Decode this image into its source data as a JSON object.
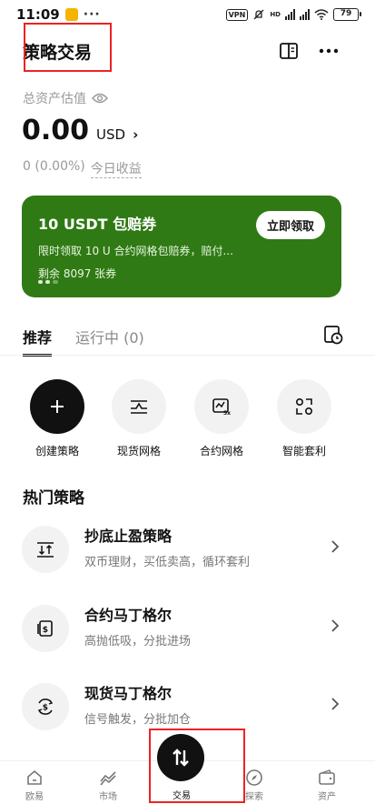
{
  "status_bar": {
    "time": "11:09",
    "dots": "···",
    "vpn": "VPN",
    "signal1": "HD",
    "battery": "79"
  },
  "header": {
    "title": "策略交易"
  },
  "assets": {
    "label": "总资产估值",
    "amount": "0.00",
    "currency": "USD",
    "arrow": "›",
    "pnl_value": "0 (0.00%)",
    "pnl_label": "今日收益"
  },
  "banner": {
    "title": "10 USDT 包赔券",
    "description": "限时领取 10 U 合约网格包赔券，赔付...",
    "remaining": "剩余 8097 张券",
    "button": "立即领取",
    "color": "#2f7a14"
  },
  "tabs": [
    {
      "label": "推荐",
      "active": true
    },
    {
      "label": "运行中 (0)",
      "active": false
    }
  ],
  "actions": [
    {
      "label": "创建策略",
      "icon": "plus-icon"
    },
    {
      "label": "现货网格",
      "icon": "grid-icon"
    },
    {
      "label": "合约网格",
      "icon": "futures-grid-icon"
    },
    {
      "label": "智能套利",
      "icon": "arbitrage-icon"
    }
  ],
  "hot": {
    "title": "热门策略",
    "items": [
      {
        "name": "抄底止盈策略",
        "desc": "双币理财，买低卖高，循环套利",
        "icon": "swap-icon"
      },
      {
        "name": "合约马丁格尔",
        "desc": "高抛低吸，分批进场",
        "icon": "dollar-card-icon"
      },
      {
        "name": "现货马丁格尔",
        "desc": "信号触发，分批加仓",
        "icon": "dollar-cycle-icon"
      }
    ]
  },
  "bottom_nav": {
    "items": [
      {
        "label": "欧易",
        "icon": "home-icon"
      },
      {
        "label": "市场",
        "icon": "market-icon"
      },
      {
        "label": "交易",
        "icon": "trade-icon"
      },
      {
        "label": "探索",
        "icon": "compass-icon"
      },
      {
        "label": "资产",
        "icon": "wallet-icon"
      }
    ]
  },
  "highlight_color": "#ee2222"
}
